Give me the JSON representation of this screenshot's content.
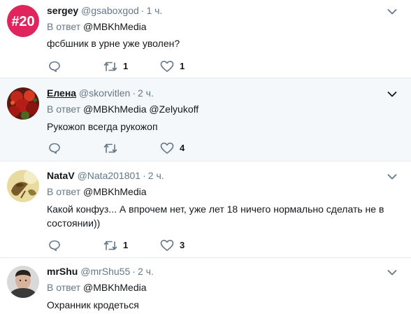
{
  "tweets": [
    {
      "name": "sergey",
      "handle": "@gsaboxgod",
      "sep": "·",
      "time": "1 ч.",
      "reply_prefix": "В ответ",
      "reply_to": "@MBKhMedia",
      "text": "фсбшник в урне уже уволен?",
      "retweets": "1",
      "likes": "1",
      "avatar_text": "#20"
    },
    {
      "name": "Елена",
      "handle": "@skorvitlen",
      "sep": "·",
      "time": "2 ч.",
      "reply_prefix": "В ответ",
      "reply_to": "@MBKhMedia @Zelyukoff",
      "text": "Рукожоп всегда рукожоп",
      "retweets": "",
      "likes": "4"
    },
    {
      "name": "NataV",
      "handle": "@Nata201801",
      "sep": "·",
      "time": "2 ч.",
      "reply_prefix": "В ответ",
      "reply_to": "@MBKhMedia",
      "text_line1": "Какой конфуз... А впрочем нет, уже лет 18 ничего нормально сделать не в",
      "text_line2": "состоянии))",
      "retweets": "1",
      "likes": "3"
    },
    {
      "name": "mrShu",
      "handle": "@mrShu55",
      "sep": "·",
      "time": "2 ч.",
      "reply_prefix": "В ответ",
      "reply_to": "@MBKhMedia",
      "text": "Охранник кродеться"
    }
  ],
  "colors": {
    "text": "#14171a",
    "muted": "#657786",
    "divider": "#e6ecf0",
    "highlight_bg": "#f5f8fa",
    "avatar_red": "#e0245e"
  }
}
